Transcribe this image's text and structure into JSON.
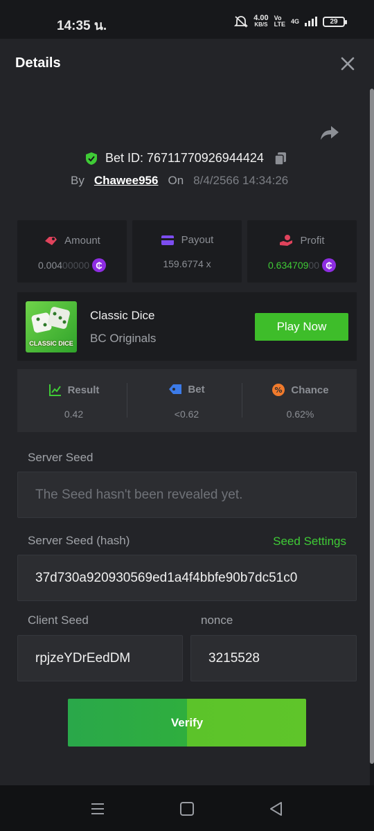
{
  "status_bar": {
    "time": "14:35 น.",
    "net_speed": "4.00",
    "net_unit": "KB/S",
    "volte_top": "Vo",
    "volte_bottom": "LTE",
    "network": "4G",
    "battery": "29"
  },
  "header": {
    "title": "Details",
    "close_icon": "close-icon"
  },
  "bet": {
    "id_label": "Bet ID: 76711770926944424",
    "by_label": "By",
    "user": "Chawee956",
    "on_label": "On",
    "date": "8/4/2566 14:34:26"
  },
  "stats": {
    "amount_label": "Amount",
    "amount_main": "0.004",
    "amount_dim": "00000",
    "payout_label": "Payout",
    "payout_value": "159.6774 x",
    "profit_label": "Profit",
    "profit_main": "0.634709",
    "profit_dim": "00",
    "coin_symbol": "₵"
  },
  "game": {
    "thumb_text": "CLASSIC DICE",
    "name": "Classic Dice",
    "provider": "BC Originals",
    "play_label": "Play Now"
  },
  "result": {
    "result_label": "Result",
    "result_value": "0.42",
    "bet_label": "Bet",
    "bet_value": "<0.62",
    "chance_label": "Chance",
    "chance_value": "0.62%"
  },
  "fairness": {
    "server_seed_label": "Server Seed",
    "server_seed_value": "The Seed hasn't been revealed yet.",
    "server_hash_label": "Server Seed (hash)",
    "seed_settings_label": "Seed Settings",
    "server_hash_value": "37d730a920930569ed1a4f4bbfe90b7dc51c0",
    "client_seed_label": "Client Seed",
    "client_seed_value": "rpjzeYDrEedDM",
    "nonce_label": "nonce",
    "nonce_value": "3215528",
    "verify_label": "Verify"
  },
  "colors": {
    "accent_green": "#3fcb36",
    "coin_purple": "#8e2de2",
    "background": "#232428"
  }
}
